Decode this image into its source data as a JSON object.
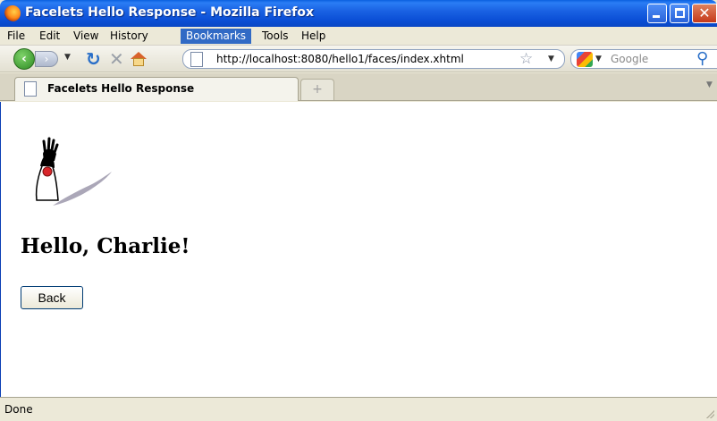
{
  "window": {
    "title": "Facelets Hello Response - Mozilla Firefox",
    "accent": "#0b4fd6"
  },
  "menu": {
    "items": [
      "File",
      "Edit",
      "View",
      "History",
      "Bookmarks",
      "Tools",
      "Help"
    ],
    "active": "Bookmarks"
  },
  "nav": {
    "url": "http://localhost:8080/hello1/faces/index.xhtml",
    "search_placeholder": "Google",
    "icons": [
      "back-icon",
      "forward-icon",
      "history-dropdown-icon",
      "reload-icon",
      "stop-icon",
      "home-icon",
      "bookmark-star-icon",
      "search-engine-icon",
      "search-magnifier-icon"
    ]
  },
  "tabs": [
    {
      "label": "Facelets Hello Response",
      "selected": true
    }
  ],
  "page": {
    "greeting": "Hello, Charlie!",
    "back_label": "Back"
  },
  "status": {
    "text": "Done"
  }
}
